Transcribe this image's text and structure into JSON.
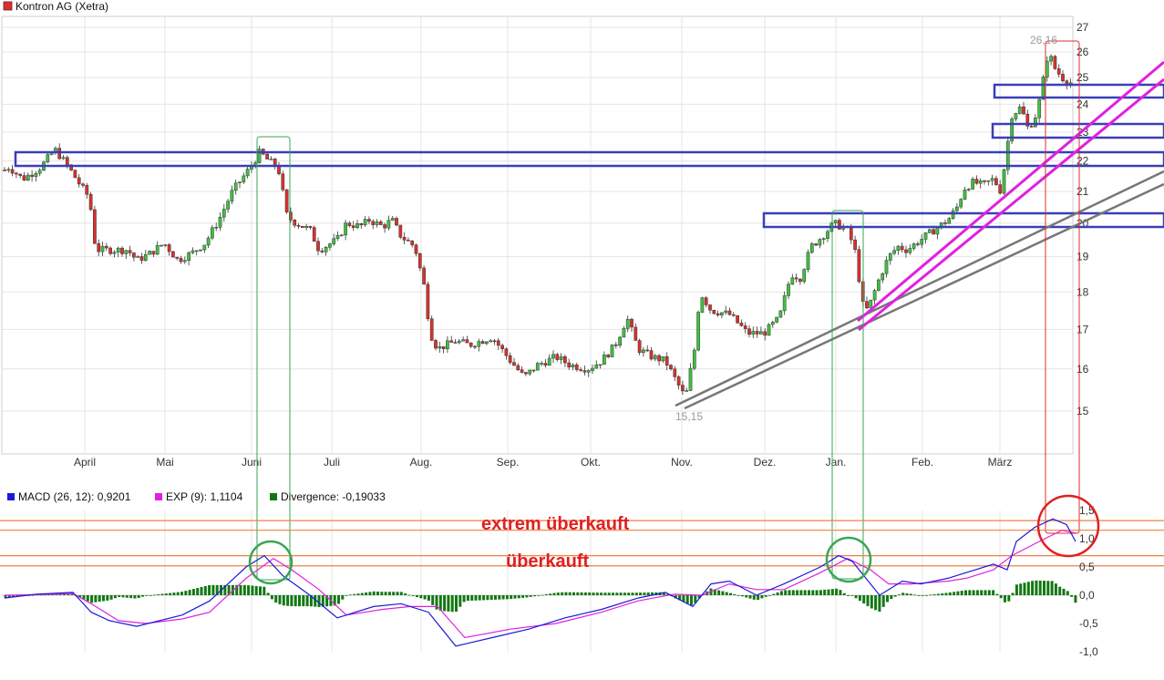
{
  "header": {
    "title": "Kontron AG (Xetra)",
    "color": "#d9312d"
  },
  "colors": {
    "up": "#3fc23f",
    "down": "#d9312d",
    "macd": "#1a1ad8",
    "signal": "#e020e0",
    "divergence": "#137813",
    "channel": "#3a3fb8",
    "trend_gray": "#777777",
    "trend_magenta": "#e020e0",
    "box_green": "#3aa655",
    "box_red": "#d9312d",
    "orange_line": "#f08040",
    "grid": "#e4e4e4"
  },
  "chart_data": [
    {
      "type": "candlestick",
      "title": "Kontron AG (Xetra)",
      "x_labels": [
        "April",
        "Mai",
        "Juni",
        "Juli",
        "Aug.",
        "Sep.",
        "Okt.",
        "Nov.",
        "Dez.",
        "Jan.",
        "Feb.",
        "März"
      ],
      "y_ticks": [
        "15",
        "16",
        "17",
        "18",
        "19",
        "20",
        "21",
        "22",
        "23",
        "24",
        "25",
        "26",
        "27"
      ],
      "ylim": [
        14,
        27.1
      ],
      "scale": "log",
      "grid": true,
      "annotations": {
        "high": "26,16",
        "low": "15,15"
      },
      "close_path": [
        [
          0,
          21.6
        ],
        [
          10,
          21.8
        ],
        [
          25,
          21.4
        ],
        [
          45,
          21.8
        ],
        [
          60,
          22.4
        ],
        [
          75,
          21.8
        ],
        [
          88,
          21.2
        ],
        [
          98,
          20.8
        ],
        [
          105,
          19.2
        ],
        [
          118,
          19.2
        ],
        [
          140,
          19.2
        ],
        [
          150,
          18.9
        ],
        [
          165,
          19.1
        ],
        [
          180,
          19.4
        ],
        [
          195,
          18.9
        ],
        [
          210,
          19.1
        ],
        [
          225,
          19.4
        ],
        [
          240,
          20.1
        ],
        [
          255,
          21
        ],
        [
          265,
          21.4
        ],
        [
          275,
          21.8
        ],
        [
          285,
          22.3
        ],
        [
          295,
          22
        ],
        [
          305,
          21.8
        ],
        [
          315,
          20.2
        ],
        [
          325,
          20
        ],
        [
          340,
          19.8
        ],
        [
          350,
          19.2
        ],
        [
          370,
          19.5
        ],
        [
          380,
          20
        ],
        [
          395,
          19.9
        ],
        [
          405,
          20.1
        ],
        [
          420,
          19.9
        ],
        [
          430,
          20.1
        ],
        [
          440,
          19.6
        ],
        [
          455,
          19.3
        ],
        [
          465,
          18.2
        ],
        [
          472,
          16.9
        ],
        [
          480,
          16.5
        ],
        [
          500,
          16.7
        ],
        [
          515,
          16.6
        ],
        [
          540,
          16.8
        ],
        [
          560,
          16.2
        ],
        [
          575,
          15.8
        ],
        [
          590,
          16.1
        ],
        [
          610,
          16.3
        ],
        [
          625,
          16.1
        ],
        [
          645,
          16
        ],
        [
          660,
          16.2
        ],
        [
          675,
          16.6
        ],
        [
          688,
          17.3
        ],
        [
          700,
          16.5
        ],
        [
          715,
          16.3
        ],
        [
          730,
          16.2
        ],
        [
          742,
          15.7
        ],
        [
          752,
          15.3
        ],
        [
          762,
          16.5
        ],
        [
          768,
          18
        ],
        [
          780,
          17.5
        ],
        [
          800,
          17.4
        ],
        [
          820,
          16.9
        ],
        [
          838,
          16.9
        ],
        [
          855,
          17.3
        ],
        [
          868,
          18.5
        ],
        [
          878,
          18.4
        ],
        [
          890,
          19.3
        ],
        [
          902,
          19.6
        ],
        [
          915,
          20
        ],
        [
          930,
          19.8
        ],
        [
          940,
          19
        ],
        [
          945,
          17.7
        ],
        [
          952,
          17.5
        ],
        [
          965,
          18.4
        ],
        [
          975,
          19
        ],
        [
          985,
          19.3
        ],
        [
          995,
          19.2
        ],
        [
          1010,
          19.5
        ],
        [
          1025,
          19.8
        ],
        [
          1040,
          20.1
        ],
        [
          1050,
          20.5
        ],
        [
          1058,
          21.1
        ],
        [
          1068,
          21.3
        ],
        [
          1078,
          21.2
        ],
        [
          1090,
          21.4
        ],
        [
          1098,
          21
        ],
        [
          1105,
          22.5
        ],
        [
          1110,
          23.6
        ],
        [
          1120,
          23.9
        ],
        [
          1128,
          23.1
        ],
        [
          1138,
          23.7
        ],
        [
          1145,
          25
        ],
        [
          1150,
          26
        ],
        [
          1158,
          25.3
        ],
        [
          1168,
          24.9
        ],
        [
          1175,
          24.8
        ],
        [
          1178,
          23
        ]
      ]
    },
    {
      "type": "line",
      "series": [
        {
          "name": "MACD (26, 12): 0,9201",
          "color": "#1a1ad8"
        },
        {
          "name": "EXP (9): 1,1104",
          "color": "#e020e0"
        },
        {
          "name": "Divergence: -0,19033",
          "color": "#137813"
        }
      ],
      "y_ticks": [
        "-1,0",
        "-0,5",
        "0,0",
        "0,5",
        "1,0",
        "1,5"
      ],
      "ylim": [
        -1.0,
        1.6
      ],
      "zones": [
        {
          "label": "extrem überkauft",
          "low": 1.15,
          "high": 1.32
        },
        {
          "label": "überkauft",
          "low": 0.52,
          "high": 0.7
        }
      ],
      "macd_path": [
        [
          5,
          -0.05
        ],
        [
          40,
          0.02
        ],
        [
          80,
          0.05
        ],
        [
          100,
          -0.3
        ],
        [
          120,
          -0.45
        ],
        [
          150,
          -0.55
        ],
        [
          200,
          -0.35
        ],
        [
          230,
          -0.1
        ],
        [
          270,
          0.5
        ],
        [
          290,
          0.7
        ],
        [
          310,
          0.35
        ],
        [
          340,
          0
        ],
        [
          370,
          -0.4
        ],
        [
          410,
          -0.2
        ],
        [
          440,
          -0.15
        ],
        [
          470,
          -0.3
        ],
        [
          500,
          -0.9
        ],
        [
          540,
          -0.75
        ],
        [
          580,
          -0.6
        ],
        [
          620,
          -0.4
        ],
        [
          660,
          -0.25
        ],
        [
          700,
          -0.05
        ],
        [
          730,
          0.05
        ],
        [
          760,
          -0.2
        ],
        [
          780,
          0.2
        ],
        [
          800,
          0.25
        ],
        [
          830,
          0
        ],
        [
          860,
          0.2
        ],
        [
          900,
          0.5
        ],
        [
          920,
          0.7
        ],
        [
          935,
          0.6
        ],
        [
          950,
          0.3
        ],
        [
          965,
          0
        ],
        [
          990,
          0.25
        ],
        [
          1010,
          0.2
        ],
        [
          1040,
          0.3
        ],
        [
          1060,
          0.4
        ],
        [
          1090,
          0.55
        ],
        [
          1105,
          0.45
        ],
        [
          1115,
          0.95
        ],
        [
          1135,
          1.2
        ],
        [
          1155,
          1.35
        ],
        [
          1170,
          1.25
        ],
        [
          1180,
          0.95
        ]
      ],
      "signal_path": [
        [
          5,
          0
        ],
        [
          40,
          0.01
        ],
        [
          80,
          0.03
        ],
        [
          100,
          -0.15
        ],
        [
          130,
          -0.45
        ],
        [
          160,
          -0.5
        ],
        [
          200,
          -0.42
        ],
        [
          230,
          -0.3
        ],
        [
          270,
          0.3
        ],
        [
          300,
          0.65
        ],
        [
          320,
          0.45
        ],
        [
          350,
          0.1
        ],
        [
          380,
          -0.35
        ],
        [
          420,
          -0.25
        ],
        [
          450,
          -0.2
        ],
        [
          480,
          -0.2
        ],
        [
          510,
          -0.75
        ],
        [
          560,
          -0.6
        ],
        [
          610,
          -0.5
        ],
        [
          660,
          -0.3
        ],
        [
          700,
          -0.1
        ],
        [
          740,
          0.02
        ],
        [
          770,
          0
        ],
        [
          800,
          0.2
        ],
        [
          830,
          0.1
        ],
        [
          860,
          0.1
        ],
        [
          900,
          0.4
        ],
        [
          930,
          0.65
        ],
        [
          955,
          0.45
        ],
        [
          975,
          0.2
        ],
        [
          1000,
          0.2
        ],
        [
          1040,
          0.25
        ],
        [
          1060,
          0.3
        ],
        [
          1090,
          0.45
        ],
        [
          1110,
          0.7
        ],
        [
          1140,
          0.95
        ],
        [
          1165,
          1.15
        ],
        [
          1180,
          1.1
        ]
      ]
    }
  ],
  "annotations_text": {
    "extreme": "extrem überkauft",
    "over": "überkauft"
  }
}
